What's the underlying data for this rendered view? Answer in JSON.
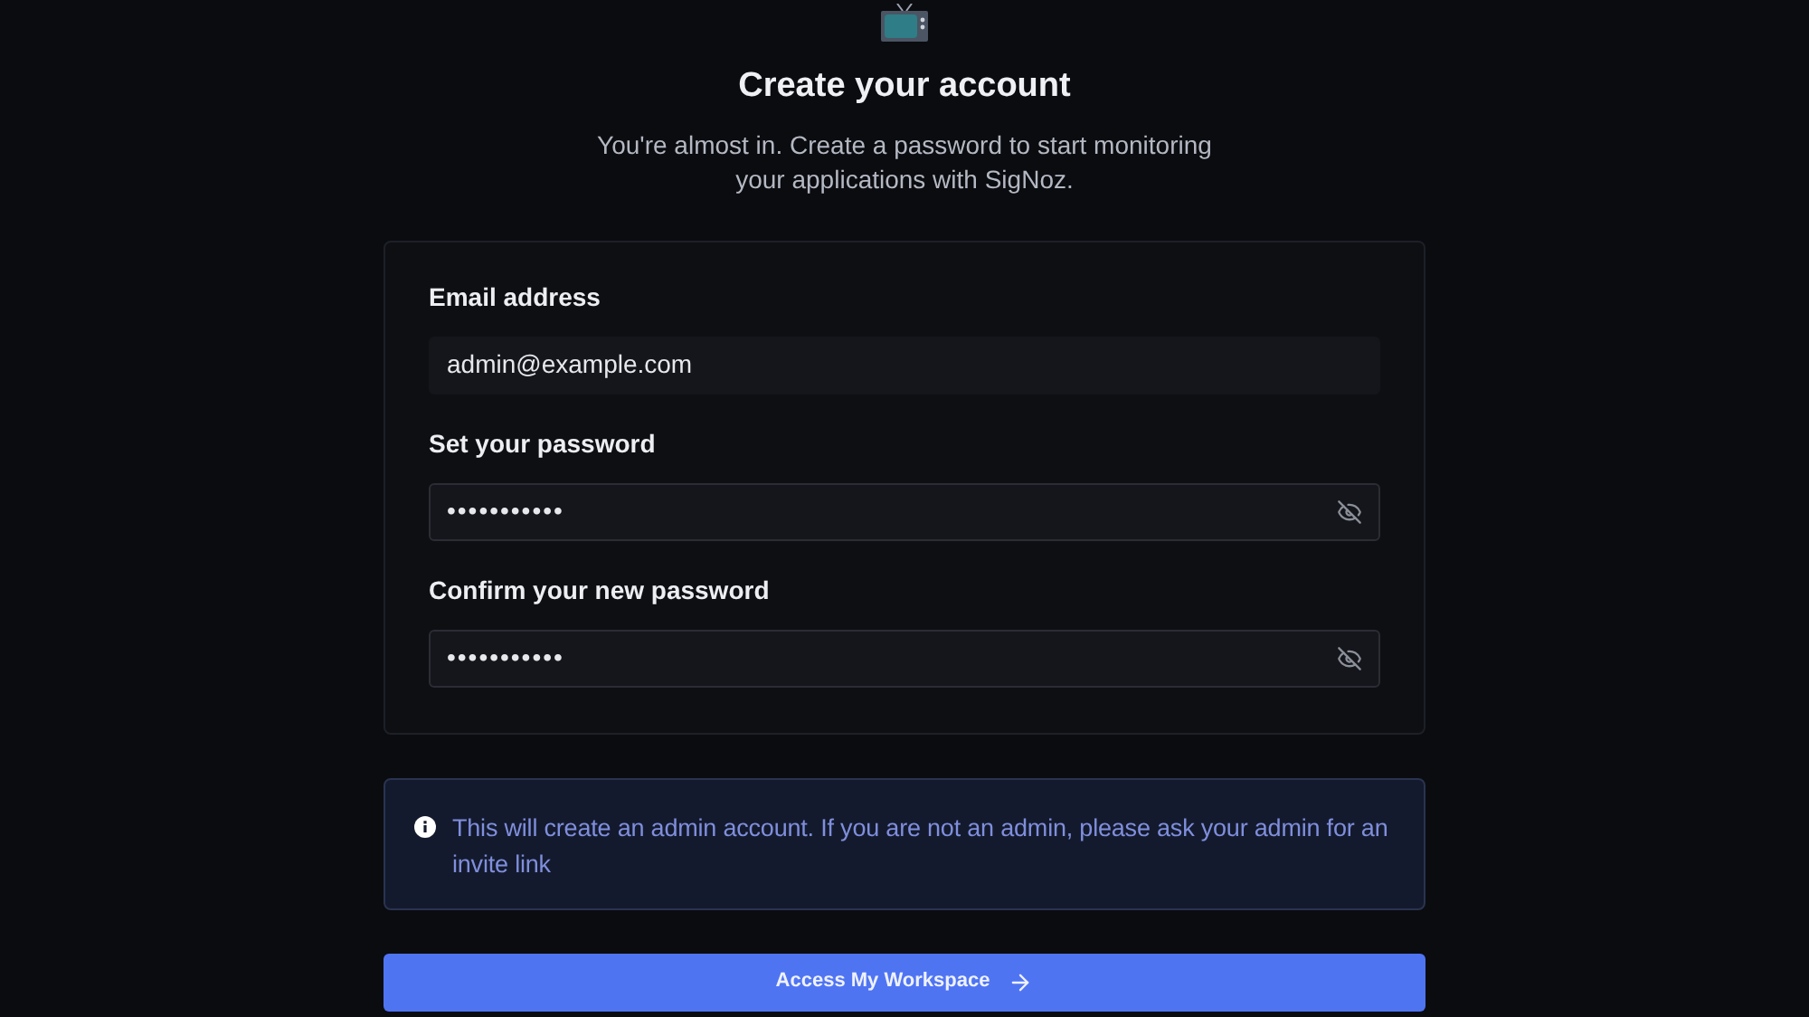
{
  "header": {
    "title": "Create your account",
    "subtitle": "You're almost in. Create a password to start monitoring your applications with SigNoz."
  },
  "fields": [
    {
      "label": "Email address",
      "value": "admin@example.com",
      "kind": "text"
    },
    {
      "label": "Set your password",
      "value": "•••••••••••",
      "kind": "password"
    },
    {
      "label": "Confirm your new password",
      "value": "•••••••••••",
      "kind": "password"
    }
  ],
  "notice": "This will create an admin account. If you are not an admin, please ask your admin for an invite link",
  "submit_button": "Access My Workspace"
}
